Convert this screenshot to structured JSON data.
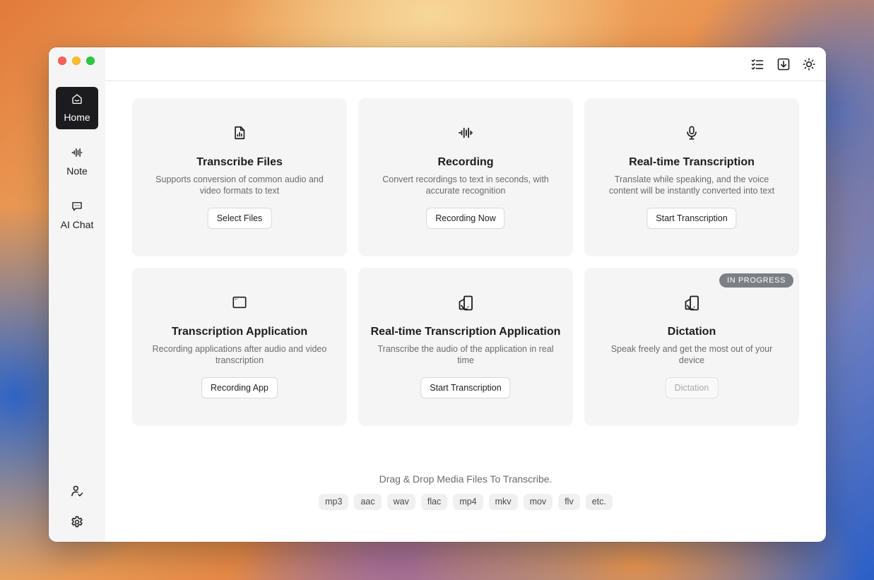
{
  "sidebar": {
    "items": [
      {
        "label": "Home",
        "icon": "home-icon",
        "active": true
      },
      {
        "label": "Note",
        "icon": "waveform-icon",
        "active": false
      },
      {
        "label": "AI Chat",
        "icon": "chat-icon",
        "active": false
      }
    ],
    "bottom_icons": [
      "user-check-icon",
      "gear-icon"
    ]
  },
  "toolbar": {
    "icons": [
      "task-list-icon",
      "download-icon",
      "sun-icon"
    ]
  },
  "cards": [
    {
      "title": "Transcribe Files",
      "description": "Supports conversion of common audio and video formats to text",
      "button": "Select Files",
      "icon": "audio-file-icon"
    },
    {
      "title": "Recording",
      "description": "Convert recordings to text in seconds, with accurate recognition",
      "button": "Recording Now",
      "icon": "waveform-icon"
    },
    {
      "title": "Real-time Transcription",
      "description": "Translate while speaking, and the voice content will be instantly converted into text",
      "button": "Start Transcription",
      "icon": "microphone-icon"
    },
    {
      "title": "Transcription Application",
      "description": "Recording applications after audio and video transcription",
      "button": "Recording App",
      "icon": "app-window-icon"
    },
    {
      "title": "Real-time Transcription Application",
      "description": "Transcribe the audio of the application in real time",
      "button": "Start Transcription",
      "icon": "app-audio-icon"
    },
    {
      "title": "Dictation",
      "description": "Speak freely and get the most out of your device",
      "button": "Dictation",
      "icon": "app-audio-icon",
      "badge": "IN PROGRESS",
      "disabled": true
    }
  ],
  "dropzone": {
    "text": "Drag & Drop Media Files To Transcribe.",
    "formats": [
      "mp3",
      "aac",
      "wav",
      "flac",
      "mp4",
      "mkv",
      "mov",
      "flv",
      "etc."
    ]
  },
  "colors": {
    "active_nav": "#1c1c1e",
    "badge": "#7b7f86",
    "card_bg": "#f5f5f5"
  }
}
